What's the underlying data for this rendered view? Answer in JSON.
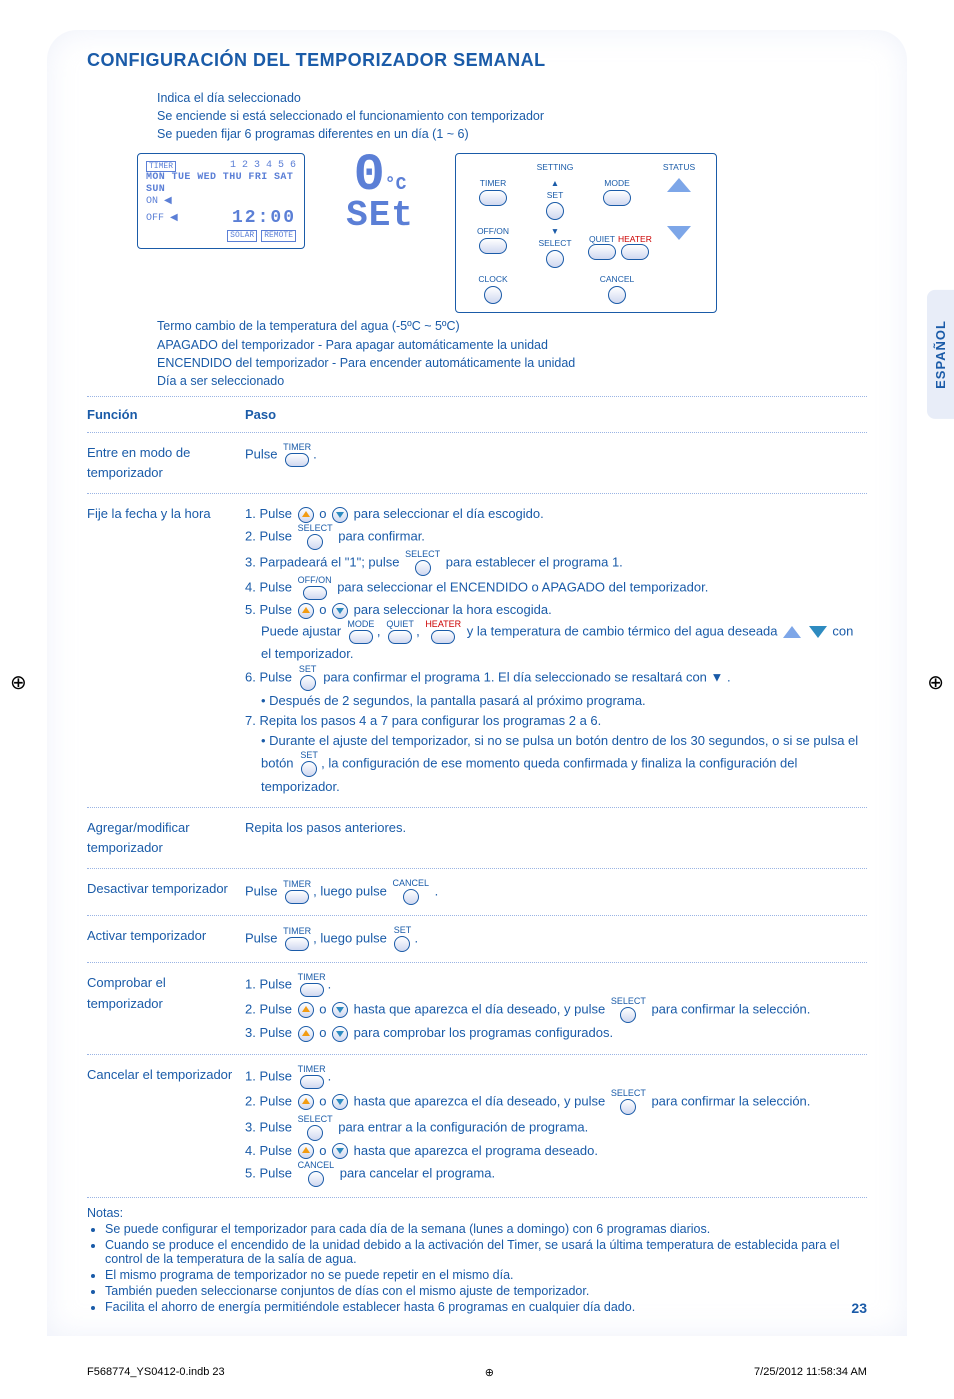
{
  "lang_tab": "ESPAÑOL",
  "title": "CONFIGURACIÓN DEL TEMPORIZADOR SEMANAL",
  "top_callouts": [
    "Indica el día seleccionado",
    "Se enciende si está seleccionado el funcionamiento con temporizador",
    "Se pueden fijar 6 programas diferentes en un día (1 ~ 6)"
  ],
  "lcd": {
    "timer_label": "TIMER",
    "programs": "1 2 3 4 5 6",
    "days": "MON TUE WED THU FRI SAT SUN",
    "on": "ON ◀",
    "off": "OFF ◀",
    "time": "12:00",
    "solar": "SOLAR",
    "remote": "REMOTE"
  },
  "sevenseg": {
    "temp": "0",
    "unit": "°C",
    "set": "SEt"
  },
  "btn_panel": {
    "setting": "SETTING",
    "status": "STATUS",
    "timer": "TIMER",
    "set": "SET",
    "mode": "MODE",
    "off_on": "OFF/ON",
    "select": "SELECT",
    "quiet": "QUIET",
    "heater": "HEATER",
    "clock": "CLOCK",
    "cancel": "CANCEL"
  },
  "bottom_callouts": [
    "Termo cambio de la temperatura del agua (-5ºC ~ 5ºC)",
    "APAGADO del temporizador - Para apagar automáticamente la unidad",
    "ENCENDIDO del temporizador - Para encender automáticamente la unidad",
    "Día a ser seleccionado"
  ],
  "table": {
    "hdr_func": "Función",
    "hdr_step": "Paso",
    "rows": [
      {
        "func": "Entre en modo de temporizador",
        "steps": [
          {
            "prefix": "Pulse ",
            "icon": "timer-oval",
            "label": "TIMER",
            "suffix": "."
          }
        ]
      },
      {
        "func": "Fije la fecha y la hora",
        "steps": [
          {
            "text": "1. Pulse ",
            "icon1": "circ-up",
            "mid": " o ",
            "icon2": "circ-down",
            "suffix": " para seleccionar el día escogido."
          },
          {
            "text": "2. Pulse ",
            "icon1": "select-circ",
            "label": "SELECT",
            "suffix": "  para confirmar."
          },
          {
            "text": "3. Parpadeará el \"1\"; pulse ",
            "icon1": "select-circ",
            "label": "SELECT",
            "suffix": "  para establecer el programa 1."
          },
          {
            "text": "4. Pulse ",
            "icon1": "offon-oval",
            "label": "OFF/ON",
            "suffix": " para seleccionar el ENCENDIDO o APAGADO del temporizador."
          },
          {
            "text": "5. Pulse ",
            "icon1": "circ-up",
            "mid": " o ",
            "icon2": "circ-down",
            "suffix": " para seleccionar la hora escogida."
          },
          {
            "text_html": "Puede ajustar |mode-oval|, |quiet-oval|, |heater-oval| y la temperatura de cambio térmico del agua deseada |tri-up| |tri-down| con el temporizador.",
            "labels": [
              "MODE",
              "QUIET",
              "HEATER"
            ]
          },
          {
            "text": "6. Pulse ",
            "icon1": "set-circ",
            "label": "SET",
            "suffix": " para confirmar el programa 1. El día seleccionado se resaltará con ▼ ."
          },
          {
            "bullet": "• Después de 2 segundos, la pantalla pasará al próximo programa."
          },
          {
            "plain": "7. Repita los pasos 4 a 7 para configurar los programas 2 a 6."
          },
          {
            "bullet_html": "• Durante el ajuste del temporizador, si no se pulsa un botón dentro de los 30 segundos, o si se pulsa el botón |set-circ|, la configuración de ese momento queda confirmada y finaliza la configuración del temporizador.",
            "label": "SET"
          }
        ]
      },
      {
        "func": "Agregar/modificar temporizador",
        "steps": [
          {
            "plain": "Repita los pasos anteriores."
          }
        ]
      },
      {
        "func": "Desactivar temporizador",
        "steps": [
          {
            "text": "Pulse ",
            "icon1": "timer-oval",
            "label": "TIMER",
            "mid": ", luego pulse ",
            "icon2": "cancel-circ",
            "label2": "CANCEL",
            "suffix": " ."
          }
        ]
      },
      {
        "func": "Activar temporizador",
        "steps": [
          {
            "text": "Pulse ",
            "icon1": "timer-oval",
            "label": "TIMER",
            "mid": ", luego pulse ",
            "icon2": "set-circ",
            "label2": "SET",
            "suffix": "."
          }
        ]
      },
      {
        "func": "Comprobar el temporizador",
        "steps": [
          {
            "text": "1. Pulse ",
            "icon1": "timer-oval",
            "label": "TIMER",
            "suffix": "."
          },
          {
            "text": "2. Pulse ",
            "icon1": "circ-up",
            "mid": " o ",
            "icon2": "circ-down",
            "suffix": " hasta que aparezca el día deseado, y pulse ",
            "icon3": "select-circ",
            "label3": "SELECT",
            "suffix2": "  para confirmar la selección."
          },
          {
            "text": "3. Pulse ",
            "icon1": "circ-up",
            "mid": " o ",
            "icon2": "circ-down",
            "suffix": " para comprobar los programas configurados."
          }
        ]
      },
      {
        "func": "Cancelar el temporizador",
        "steps": [
          {
            "text": "1. Pulse ",
            "icon1": "timer-oval",
            "label": "TIMER",
            "suffix": "."
          },
          {
            "text": "2. Pulse ",
            "icon1": "circ-up",
            "mid": " o ",
            "icon2": "circ-down",
            "suffix": " hasta que aparezca el día deseado, y pulse ",
            "icon3": "select-circ",
            "label3": "SELECT",
            "suffix2": "  para confirmar la selección."
          },
          {
            "text": "3. Pulse ",
            "icon1": "select-circ",
            "label": "SELECT",
            "suffix": "  para entrar a la configuración de programa."
          },
          {
            "text": "4. Pulse ",
            "icon1": "circ-up",
            "mid": " o ",
            "icon2": "circ-down",
            "suffix": " hasta que aparezca el programa deseado."
          },
          {
            "text": "5. Pulse ",
            "icon1": "cancel-circ",
            "label": "CANCEL",
            "suffix": "  para cancelar el programa."
          }
        ]
      }
    ]
  },
  "notes_title": "Notas:",
  "notes": [
    "Se puede configurar el temporizador para cada día de la semana (lunes a domingo) con 6 programas diarios.",
    "Cuando se produce el encendido de la unidad debido a la activación del Timer, se usará la última temperatura de establecida para el control de la temperatura de la salía de agua.",
    "El mismo programa de temporizador no se puede repetir en el mismo día.",
    "También pueden seleccionarse conjuntos de días con el mismo ajuste de temporizador.",
    "Facilita el ahorro de energía permitiéndole establecer hasta 6 programas en cualquier día dado."
  ],
  "page_num": "23",
  "footer_left": "F568774_YS0412-0.indb   23",
  "footer_right": "7/25/2012   11:58:34 AM"
}
